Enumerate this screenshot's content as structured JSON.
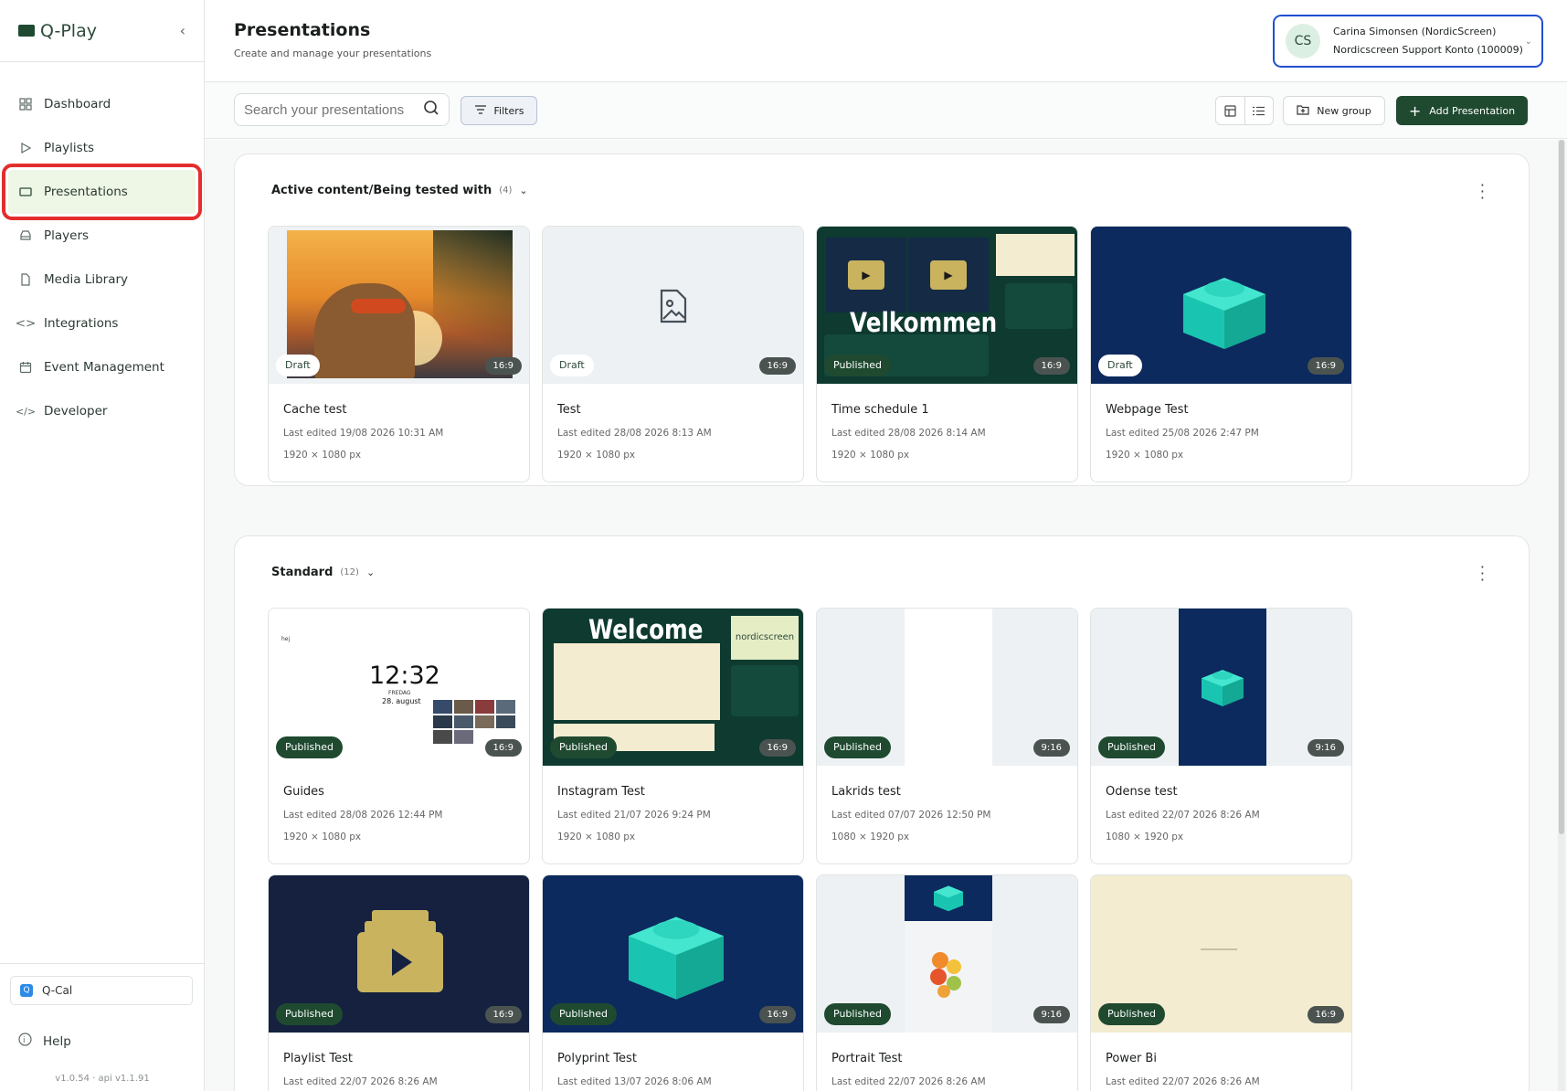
{
  "app": {
    "name": "Q-Play",
    "version": "v1.0.54 · api v1.1.91"
  },
  "sidebar": {
    "items": [
      {
        "label": "Dashboard",
        "icon": "dashboard-icon"
      },
      {
        "label": "Playlists",
        "icon": "play-icon"
      },
      {
        "label": "Presentations",
        "icon": "presentation-icon",
        "active": true
      },
      {
        "label": "Players",
        "icon": "player-icon"
      },
      {
        "label": "Media Library",
        "icon": "file-icon"
      },
      {
        "label": "Integrations",
        "icon": "code-icon"
      },
      {
        "label": "Event Management",
        "icon": "calendar-icon"
      },
      {
        "label": "Developer",
        "icon": "developer-icon"
      }
    ],
    "qcal": "Q-Cal",
    "help": "Help"
  },
  "header": {
    "title": "Presentations",
    "subtitle": "Create and manage your presentations",
    "account": {
      "initials": "CS",
      "name": "Carina Simonsen (NordicScreen)",
      "org": "Nordicscreen Support Konto (100009)"
    }
  },
  "toolbar": {
    "search_placeholder": "Search your presentations",
    "filters": "Filters",
    "new_group": "New group",
    "add_presentation": "Add Presentation"
  },
  "groups": [
    {
      "name": "Active content/Being tested with",
      "count": "(4)",
      "cards": [
        {
          "title": "Cache test",
          "edited": "Last edited 19/08 2026 10:31 AM",
          "size": "1920 × 1080 px",
          "status": "Draft",
          "ratio": "16:9"
        },
        {
          "title": "Test",
          "edited": "Last edited 28/08 2026 8:13 AM",
          "size": "1920 × 1080 px",
          "status": "Draft",
          "ratio": "16:9"
        },
        {
          "title": "Time schedule 1",
          "edited": "Last edited 28/08 2026 8:14 AM",
          "size": "1920 × 1080 px",
          "status": "Published",
          "ratio": "16:9",
          "thumb_text": "Velkommen"
        },
        {
          "title": "Webpage Test",
          "edited": "Last edited 25/08 2026 2:47 PM",
          "size": "1920 × 1080 px",
          "status": "Draft",
          "ratio": "16:9"
        }
      ]
    },
    {
      "name": "Standard",
      "count": "(12)",
      "cards": [
        {
          "title": "Guides",
          "edited": "Last edited 28/08 2026 12:44 PM",
          "size": "1920 × 1080 px",
          "status": "Published",
          "ratio": "16:9",
          "thumb_time": "12:32",
          "thumb_day": "FREDAG",
          "thumb_date": "28. august",
          "thumb_tag": "hej"
        },
        {
          "title": "Instagram Test",
          "edited": "Last edited 21/07 2026 9:24 PM",
          "size": "1920 × 1080 px",
          "status": "Published",
          "ratio": "16:9",
          "thumb_text": "Welcome",
          "thumb_logo": "nordicscreen"
        },
        {
          "title": "Lakrids test",
          "edited": "Last edited 07/07 2026 12:50 PM",
          "size": "1080 × 1920 px",
          "status": "Published",
          "ratio": "9:16"
        },
        {
          "title": "Odense test",
          "edited": "Last edited 22/07 2026 8:26 AM",
          "size": "1080 × 1920 px",
          "status": "Published",
          "ratio": "9:16"
        },
        {
          "title": "Playlist Test",
          "edited": "Last edited 22/07 2026 8:26 AM",
          "size": "",
          "status": "Published",
          "ratio": "16:9"
        },
        {
          "title": "Polyprint Test",
          "edited": "Last edited 13/07 2026 8:06 AM",
          "size": "",
          "status": "Published",
          "ratio": "16:9"
        },
        {
          "title": "Portrait Test",
          "edited": "Last edited 22/07 2026 8:26 AM",
          "size": "",
          "status": "Published",
          "ratio": "9:16"
        },
        {
          "title": "Power Bi",
          "edited": "Last edited 22/07 2026 8:26 AM",
          "size": "",
          "status": "Published",
          "ratio": "16:9"
        }
      ]
    }
  ],
  "colors": {
    "brand": "#1f4a30",
    "active_bg": "#eef6e6",
    "highlight": "#e42d2d",
    "account_border": "#1f4fd1"
  }
}
